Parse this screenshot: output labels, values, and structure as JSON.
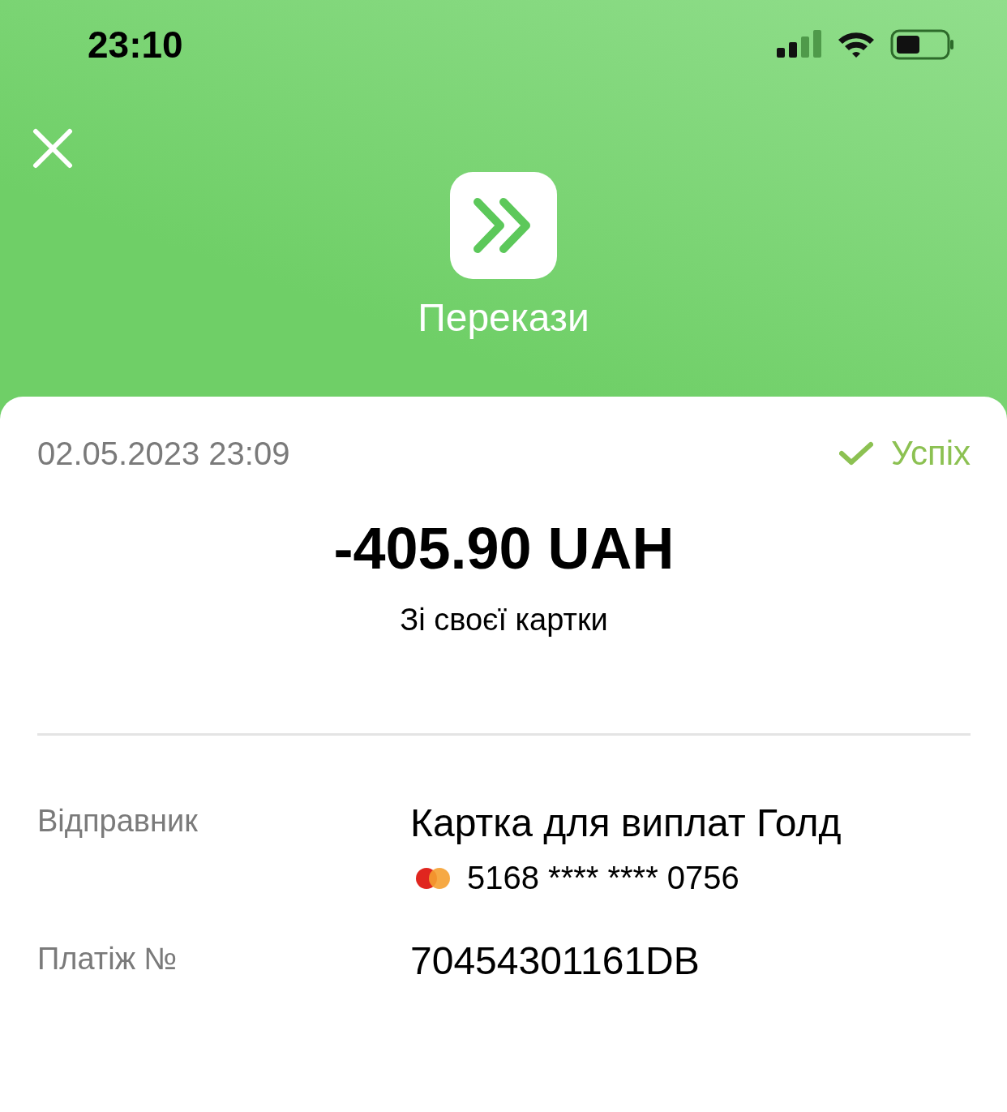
{
  "status_bar": {
    "time": "23:10"
  },
  "header": {
    "title": "Перекази"
  },
  "transaction": {
    "datetime": "02.05.2023 23:09",
    "status": {
      "label": "Успіх",
      "kind": "success"
    },
    "amount": "-405.90 UAH",
    "description": "Зі своєї картки"
  },
  "details": [
    {
      "label": "Відправник",
      "value": "Картка для виплат Голд",
      "card_number": "5168 **** **** 0756"
    },
    {
      "label": "Платіж №",
      "value": "70454301161DB"
    }
  ]
}
